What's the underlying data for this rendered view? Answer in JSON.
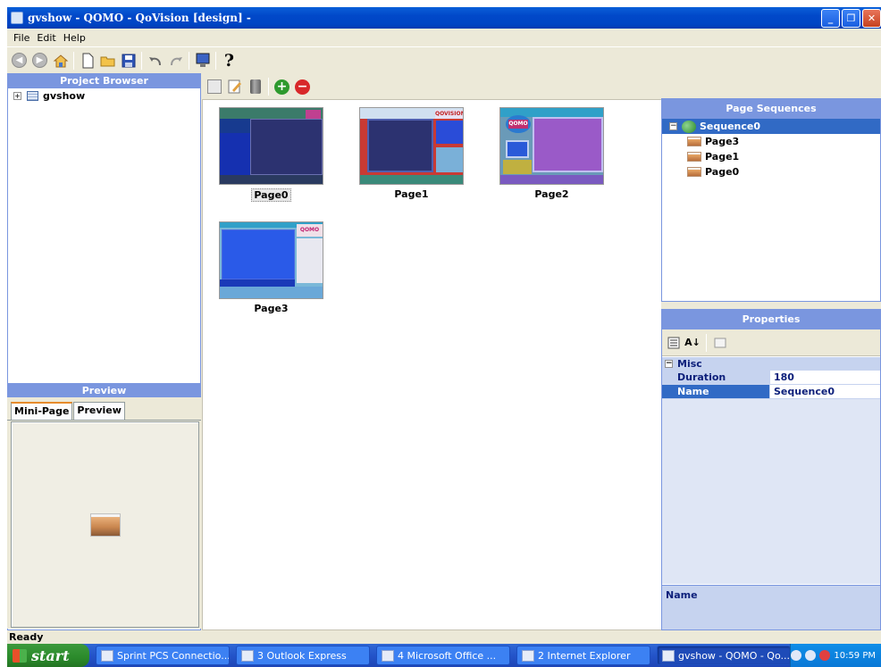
{
  "window": {
    "title": "gvshow - QOMO - QoVision [design] -",
    "buttons": {
      "minimize": "_",
      "restore": "❐",
      "close": "✕"
    }
  },
  "menu": [
    "File",
    "Edit",
    "Help"
  ],
  "toolbar": {
    "icons": [
      "back-icon",
      "forward-icon",
      "home-icon",
      "new-icon",
      "open-folder-icon",
      "save-icon",
      "undo-icon",
      "redo-icon",
      "monitor-icon",
      "help-icon"
    ],
    "help_glyph": "?"
  },
  "project_browser": {
    "title": "Project Browser",
    "root": "gvshow"
  },
  "preview": {
    "title": "Preview",
    "tabs": [
      "Mini-Page",
      "Preview"
    ]
  },
  "pages": [
    {
      "label": "Page0",
      "selected": true
    },
    {
      "label": "Page1",
      "selected": false
    },
    {
      "label": "Page2",
      "selected": false
    },
    {
      "label": "Page3",
      "selected": false
    }
  ],
  "thumb_text": {
    "page1_logo": "QOVISION",
    "page2_logo": "QOMO",
    "page3_logo": "QOMO"
  },
  "sequences": {
    "title": "Page Sequences",
    "root": "Sequence0",
    "items": [
      "Page3",
      "Page1",
      "Page0"
    ]
  },
  "properties": {
    "title": "Properties",
    "category": "Misc",
    "rows": [
      {
        "name": "Duration",
        "value": "180"
      },
      {
        "name": "Name",
        "value": "Sequence0"
      }
    ],
    "description_title": "Name"
  },
  "status": "Ready",
  "taskbar": {
    "start": "start",
    "tasks": [
      "Sprint PCS Connectio...",
      "3 Outlook Express",
      "4 Microsoft Office ...",
      "2 Internet Explorer",
      "gvshow - QOMO - Qo..."
    ],
    "clock": "10:59 PM"
  },
  "colors": {
    "panel_header": "#7a96df",
    "selection": "#316ac5",
    "title_bar": "#0148c9"
  }
}
